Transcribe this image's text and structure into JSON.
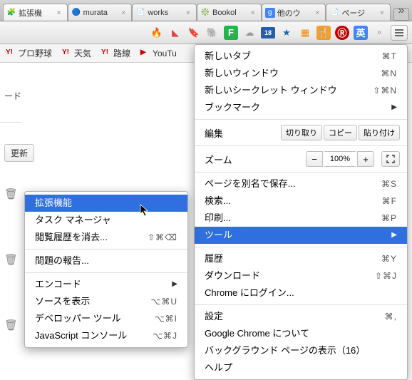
{
  "tabs": [
    {
      "favicon": "🧩",
      "title": "拡張機",
      "active": true
    },
    {
      "favicon": "🔵",
      "title": "murata",
      "active": false
    },
    {
      "favicon": "📄",
      "title": "works",
      "active": false
    },
    {
      "favicon": "❇️",
      "title": "Bookol",
      "active": false
    },
    {
      "favicon": "g",
      "title": "他のウ",
      "active": false
    },
    {
      "favicon": "📄",
      "title": "ページ",
      "active": false
    }
  ],
  "window_ctrl": "»",
  "toolbar_icons": [
    {
      "name": "flame-icon",
      "glyph": "🔥"
    },
    {
      "name": "pocket-icon",
      "glyph": "◣"
    },
    {
      "name": "bookmark-icon",
      "glyph": "🔖"
    },
    {
      "name": "evernote-icon",
      "glyph": "🐘"
    },
    {
      "name": "feedly-icon",
      "glyph": "F"
    },
    {
      "name": "cloud-icon",
      "glyph": "☁"
    },
    {
      "name": "calendar-icon",
      "glyph": "18",
      "is_date": true
    },
    {
      "name": "bookmark2-icon",
      "glyph": "★"
    },
    {
      "name": "orange-icon",
      "glyph": "▦"
    },
    {
      "name": "tabelog-icon",
      "glyph": "🍴"
    },
    {
      "name": "rakuten-icon",
      "glyph": "Ⓡ"
    },
    {
      "name": "translate-icon",
      "glyph": "英"
    }
  ],
  "bookmarks": [
    {
      "icon": "Y!",
      "label": "プロ野球"
    },
    {
      "icon": "Y!",
      "label": "天気"
    },
    {
      "icon": "Y!",
      "label": "路線"
    },
    {
      "icon": "▶",
      "label": "YouTu"
    }
  ],
  "page_fragments": {
    "row1": "ード",
    "update_btn": "更新"
  },
  "menu": {
    "new_tab": {
      "label": "新しいタブ",
      "shortcut": "⌘T"
    },
    "new_window": {
      "label": "新しいウィンドウ",
      "shortcut": "⌘N"
    },
    "new_incognito": {
      "label": "新しいシークレット ウィンドウ",
      "shortcut": "⇧⌘N"
    },
    "bookmarks": {
      "label": "ブックマーク"
    },
    "edit": {
      "label": "編集",
      "cut": "切り取り",
      "copy": "コピー",
      "paste": "貼り付け"
    },
    "zoom": {
      "label": "ズーム",
      "value": "100%"
    },
    "save_as": {
      "label": "ページを別名で保存...",
      "shortcut": "⌘S"
    },
    "find": {
      "label": "検索...",
      "shortcut": "⌘F"
    },
    "print": {
      "label": "印刷...",
      "shortcut": "⌘P"
    },
    "tools": {
      "label": "ツール"
    },
    "history": {
      "label": "履歴",
      "shortcut": "⌘Y"
    },
    "downloads": {
      "label": "ダウンロード",
      "shortcut": "⇧⌘J"
    },
    "signin": {
      "label": "Chrome にログイン..."
    },
    "settings": {
      "label": "設定",
      "shortcut": "⌘,"
    },
    "about": {
      "label": "Google Chrome について"
    },
    "bg_pages": {
      "label": "バックグラウンド ページの表示（16）"
    },
    "help": {
      "label": "ヘルプ"
    }
  },
  "submenu": {
    "extensions": {
      "label": "拡張機能"
    },
    "task_manager": {
      "label": "タスク マネージャ"
    },
    "clear_browsing": {
      "label": "閲覧履歴を消去...",
      "shortcut": "⇧⌘⌫"
    },
    "report": {
      "label": "問題の報告..."
    },
    "encoding": {
      "label": "エンコード"
    },
    "view_source": {
      "label": "ソースを表示",
      "shortcut": "⌥⌘U"
    },
    "dev_tools": {
      "label": "デベロッパー ツール",
      "shortcut": "⌥⌘I"
    },
    "js_console": {
      "label": "JavaScript コンソール",
      "shortcut": "⌥⌘J"
    }
  }
}
